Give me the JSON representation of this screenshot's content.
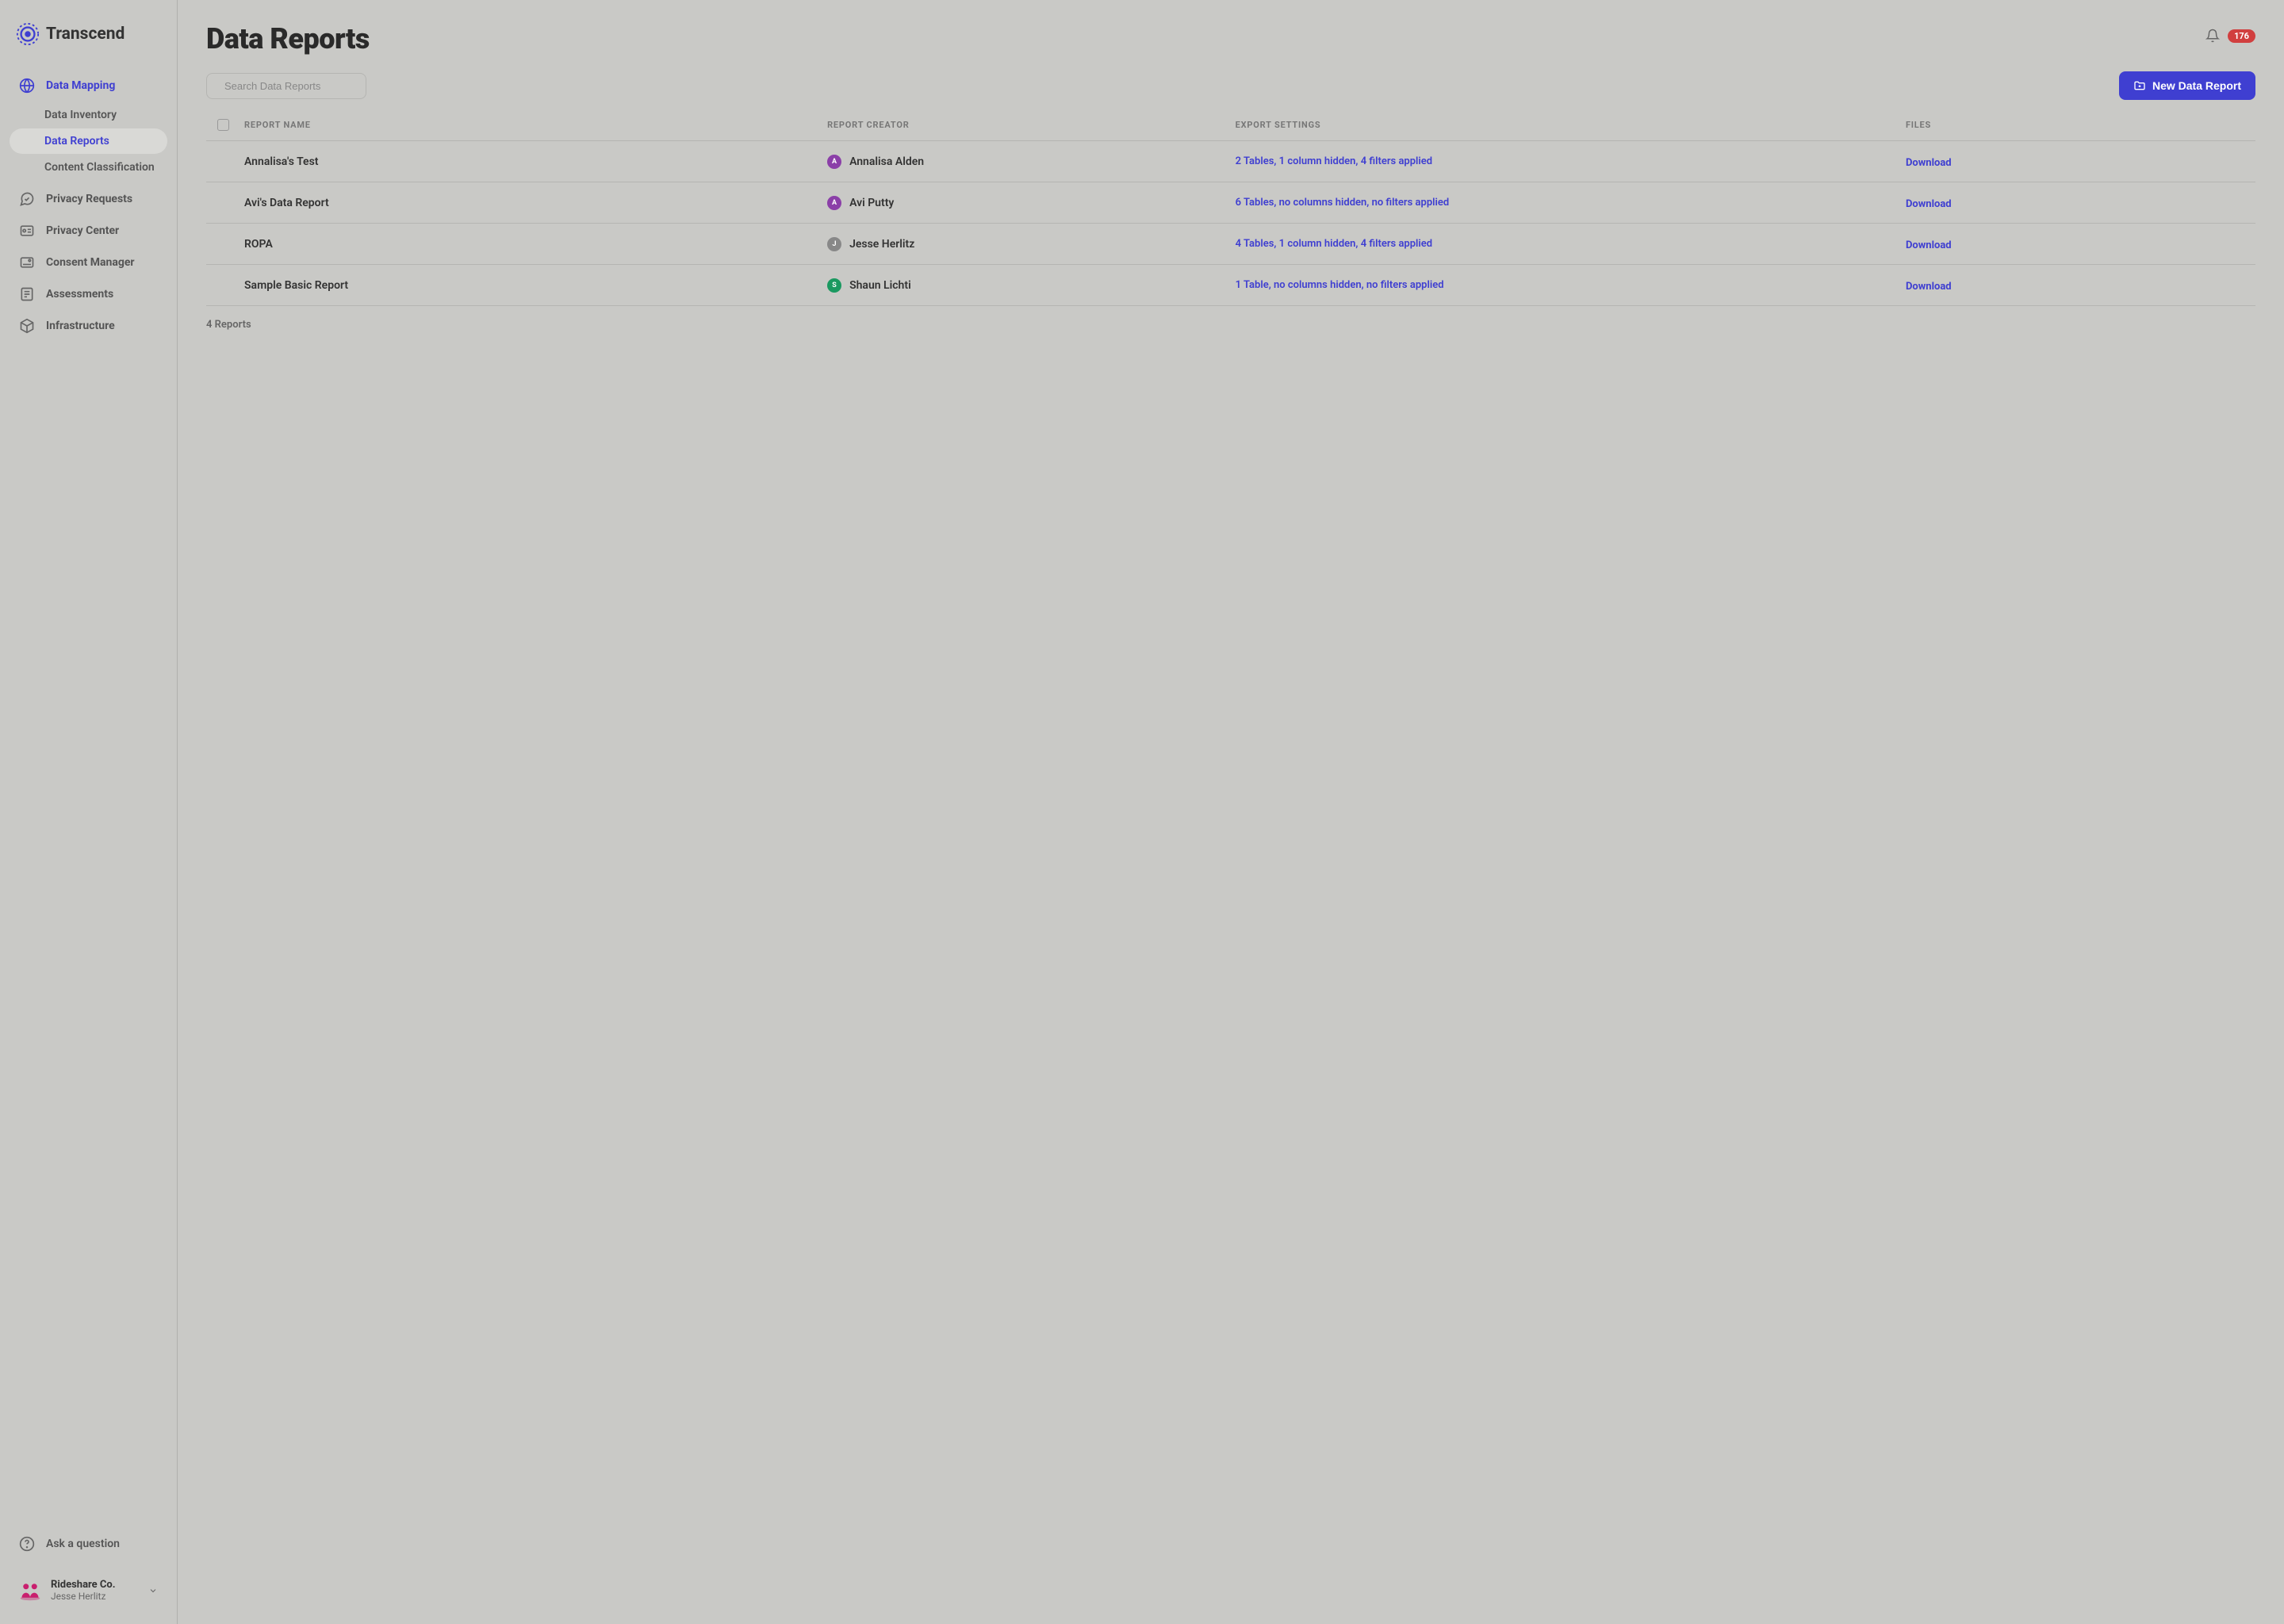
{
  "brand": "Transcend",
  "header": {
    "title": "Data Reports",
    "notif_count": "176"
  },
  "sidebar": {
    "items": [
      {
        "label": "Data Mapping",
        "icon": "globe",
        "active": true,
        "children": [
          {
            "label": "Data Inventory",
            "active": false
          },
          {
            "label": "Data Reports",
            "active": true
          },
          {
            "label": "Content Classification",
            "active": false
          }
        ]
      },
      {
        "label": "Privacy Requests",
        "icon": "chat"
      },
      {
        "label": "Privacy Center",
        "icon": "card"
      },
      {
        "label": "Consent Manager",
        "icon": "consent"
      },
      {
        "label": "Assessments",
        "icon": "assessment"
      },
      {
        "label": "Infrastructure",
        "icon": "cube"
      }
    ],
    "ask_label": "Ask a question",
    "org": {
      "name": "Rideshare Co.",
      "user": "Jesse Herlitz"
    }
  },
  "toolbar": {
    "search_placeholder": "Search Data Reports",
    "new_report_label": "New Data Report"
  },
  "table": {
    "columns": [
      "REPORT NAME",
      "REPORT CREATOR",
      "EXPORT SETTINGS",
      "FILES"
    ],
    "rows": [
      {
        "name": "Annalisa's Test",
        "creator": "Annalisa Alden",
        "initial": "A",
        "avatar_color": "#8b3fa8",
        "settings": "2 Tables, 1 column hidden, 4 filters applied",
        "file": "Download"
      },
      {
        "name": "Avi's Data Report",
        "creator": "Avi Putty",
        "initial": "A",
        "avatar_color": "#8b3fa8",
        "settings": "6 Tables, no columns hidden, no filters applied",
        "file": "Download"
      },
      {
        "name": "ROPA",
        "creator": "Jesse Herlitz",
        "initial": "J",
        "avatar_color": "#888888",
        "settings": "4 Tables, 1 column hidden, 4 filters applied",
        "file": "Download"
      },
      {
        "name": "Sample Basic Report",
        "creator": "Shaun Lichti",
        "initial": "S",
        "avatar_color": "#1a9960",
        "settings": "1 Table, no columns hidden, no filters applied",
        "file": "Download"
      }
    ],
    "count_label": "4 Reports"
  }
}
